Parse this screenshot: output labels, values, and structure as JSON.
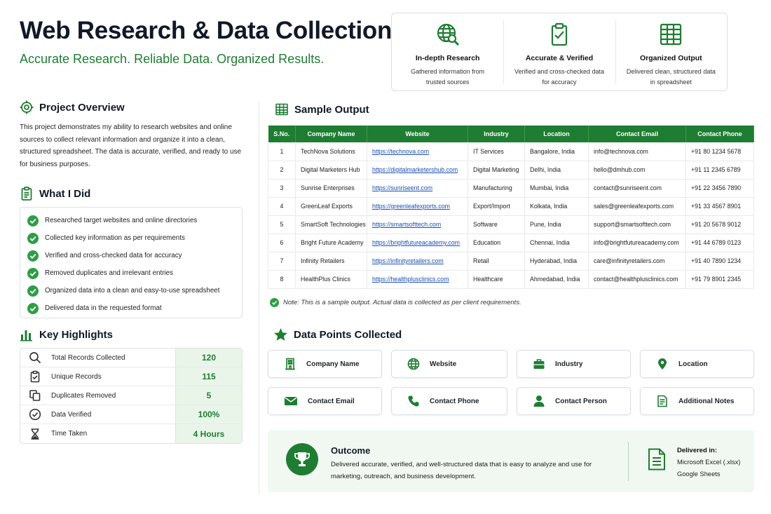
{
  "header": {
    "title": "Web Research & Data Collection",
    "subtitle": "Accurate Research. Reliable Data. Organized Results."
  },
  "features": [
    {
      "icon": "globe-search-icon",
      "title": "In-depth Research",
      "desc": "Gathered information from trusted sources"
    },
    {
      "icon": "clipboard-check-icon",
      "title": "Accurate & Verified",
      "desc": "Verified and cross-checked data for accuracy"
    },
    {
      "icon": "spreadsheet-icon",
      "title": "Organized Output",
      "desc": "Delivered clean, structured data in spreadsheet"
    }
  ],
  "overview": {
    "heading": "Project Overview",
    "text": "This project demonstrates my ability to research websites and online sources to collect relevant information and organize it into a clean, structured spreadsheet. The data is accurate, verified, and ready to use for business purposes."
  },
  "what_i_did": {
    "heading": "What I Did",
    "items": [
      "Researched target websites and online directories",
      "Collected key information as per requirements",
      "Verified and cross-checked data for accuracy",
      "Removed duplicates and irrelevant entries",
      "Organized data into a clean and easy-to-use spreadsheet",
      "Delivered data in the requested format"
    ]
  },
  "highlights": {
    "heading": "Key Highlights",
    "rows": [
      {
        "icon": "search-icon",
        "label": "Total Records Collected",
        "value": "120"
      },
      {
        "icon": "clipboard-icon",
        "label": "Unique Records",
        "value": "115"
      },
      {
        "icon": "copy-icon",
        "label": "Duplicates Removed",
        "value": "5"
      },
      {
        "icon": "check-circle-icon",
        "label": "Data Verified",
        "value": "100%"
      },
      {
        "icon": "hourglass-icon",
        "label": "Time Taken",
        "value": "4 Hours"
      }
    ]
  },
  "sample_output": {
    "heading": "Sample Output",
    "columns": [
      "S.No.",
      "Company Name",
      "Website",
      "Industry",
      "Location",
      "Contact Email",
      "Contact Phone"
    ],
    "rows": [
      [
        "1",
        "TechNova Solutions",
        "https://technova.com",
        "IT Services",
        "Bangalore, India",
        "info@technova.com",
        "+91 80 1234 5678"
      ],
      [
        "2",
        "Digital Marketers Hub",
        "https://digitalmarketershub.com",
        "Digital Marketing",
        "Delhi, India",
        "hello@dmhub.com",
        "+91 11 2345 6789"
      ],
      [
        "3",
        "Sunrise Enterprises",
        "https://sunriseent.com",
        "Manufacturing",
        "Mumbai, India",
        "contact@sunriseent.com",
        "+91 22 3456 7890"
      ],
      [
        "4",
        "GreenLeaf Exports",
        "https://greenleafexports.com",
        "Export/Import",
        "Kolkata, India",
        "sales@greenleafexports.com",
        "+91 33 4567 8901"
      ],
      [
        "5",
        "SmartSoft Technologies",
        "https://smartsofttech.com",
        "Software",
        "Pune, India",
        "support@smartsofttech.com",
        "+91 20 5678 9012"
      ],
      [
        "6",
        "Bright Future Academy",
        "https://brightfutureacademy.com",
        "Education",
        "Chennai, India",
        "info@brightfutureacademy.com",
        "+91 44 6789 0123"
      ],
      [
        "7",
        "Infinity Retailers",
        "https://infinityretailers.com",
        "Retail",
        "Hyderabad, India",
        "care@infinityretailers.com",
        "+91 40 7890 1234"
      ],
      [
        "8",
        "HealthPlus Clinics",
        "https://healthplusclinics.com",
        "Healthcare",
        "Ahmedabad, India",
        "contact@healthplusclinics.com",
        "+91 79 8901 2345"
      ]
    ],
    "note": "Note: This is a sample output. Actual data is collected as per client requirements."
  },
  "data_points": {
    "heading": "Data Points Collected",
    "items": [
      {
        "icon": "building-icon",
        "label": "Company Name"
      },
      {
        "icon": "globe-icon",
        "label": "Website"
      },
      {
        "icon": "briefcase-icon",
        "label": "Industry"
      },
      {
        "icon": "location-pin-icon",
        "label": "Location"
      },
      {
        "icon": "envelope-icon",
        "label": "Contact Email"
      },
      {
        "icon": "phone-icon",
        "label": "Contact Phone"
      },
      {
        "icon": "person-icon",
        "label": "Contact Person"
      },
      {
        "icon": "notes-icon",
        "label": "Additional Notes"
      }
    ]
  },
  "outcome": {
    "title": "Outcome",
    "desc": "Delivered accurate, verified, and well-structured data that is easy to analyze and use for marketing, outreach, and business development.",
    "delivered_title": "Delivered in:",
    "formats": [
      "Microsoft Excel (.xlsx)",
      "Google Sheets"
    ]
  },
  "colors": {
    "accent": "#1e7d32",
    "link": "#1a4fb3",
    "highlight_bg": "#eaf5ea"
  }
}
